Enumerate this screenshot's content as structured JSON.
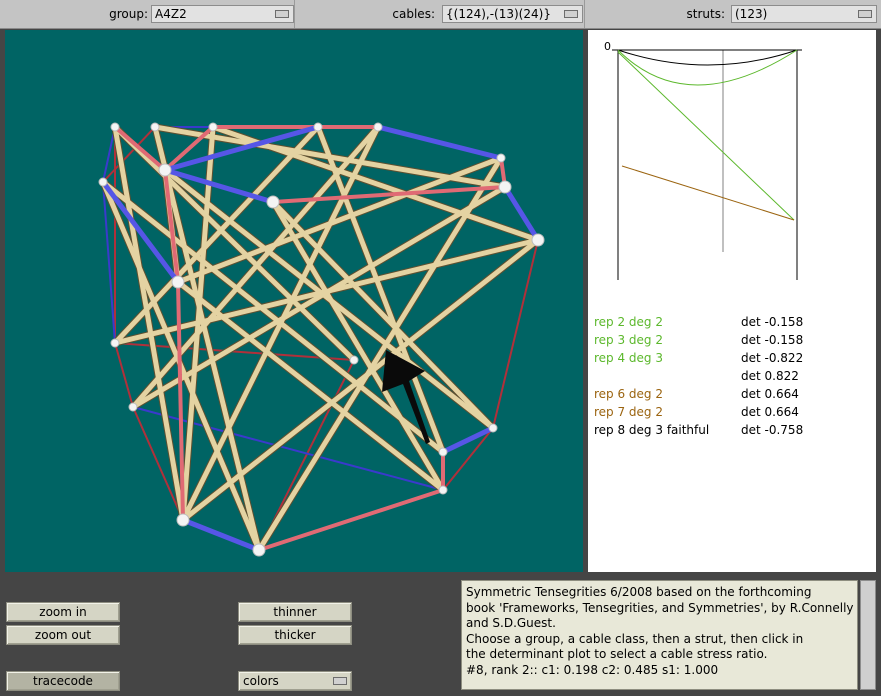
{
  "toolbar": {
    "group_label": "group:",
    "group_value": "A4Z2",
    "cables_label": "cables:",
    "cables_value": "{(124),-(13)(24)}",
    "struts_label": "struts:",
    "struts_value": "(123)"
  },
  "plot": {
    "zero_label": "0"
  },
  "reps": [
    {
      "label": "rep 2 deg 2",
      "det": "det -0.158",
      "color": "#5cb82c"
    },
    {
      "label": "rep 3 deg 2",
      "det": "det -0.158",
      "color": "#5cb82c"
    },
    {
      "label": "rep 4 deg 3",
      "det": "det -0.822",
      "color": "#5cb82c"
    },
    {
      "label": "",
      "det": "det 0.822",
      "color": "#5cb82c"
    },
    {
      "label": "rep 6 deg 2",
      "det": "det 0.664",
      "color": "#9b6410"
    },
    {
      "label": "rep 7 deg 2",
      "det": "det 0.664",
      "color": "#9b6410"
    },
    {
      "label": "rep 8 deg 3  faithful",
      "det": "det -0.758",
      "color": "#000000"
    }
  ],
  "buttons": {
    "zoom_in": "zoom in",
    "zoom_out": "zoom out",
    "thinner": "thinner",
    "thicker": "thicker",
    "tracecode": "tracecode",
    "colors": "colors"
  },
  "info": {
    "lines": [
      "Symmetric Tensegrities      6/2008     based on the forthcoming",
      "book 'Frameworks, Tensegrities, and Symmetries', by R.Connelly",
      "and S.D.Guest.",
      "    Choose a group, a cable class, then a strut, then click in",
      "the determinant plot to select a cable stress ratio.",
      " #8, rank 2::    c1:  0.198   c2:  0.485   s1:  1.000"
    ]
  },
  "colors": {
    "background": "#006464",
    "struts": "#e4d3a2",
    "cable_red": "#e06a74",
    "cable_blue": "#5656e6",
    "rep_green": "#5cb82c",
    "rep_brown": "#9b6410"
  }
}
